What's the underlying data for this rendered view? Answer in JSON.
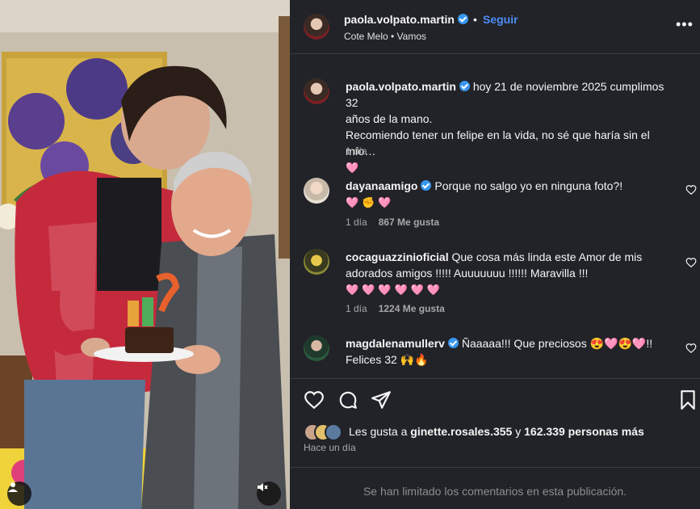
{
  "post": {
    "username": "paola.volpato.martin",
    "dot": "•",
    "follow_label": "Seguir",
    "audio": "Cote Melo • Vamos",
    "more_label": "•••"
  },
  "caption": {
    "username": "paola.volpato.martin",
    "text_line1": "hoy 21 de noviembre 2025 cumplimos 32",
    "text_line2": "años de la mano.",
    "text_line3": "Recomiendo tener un felipe en la vida, no sé que haría sin el mío…",
    "emoji": "🩷",
    "time": "1 día"
  },
  "comments": [
    {
      "username": "dayanaamigo",
      "text": "Porque no salgo yo en ninguna foto?!",
      "emoji": "🩷✊🩷",
      "time": "1 día",
      "likes": "867 Me gusta"
    },
    {
      "username": "cocaguazzinioficial",
      "text": "Que cosa más linda este Amor de mis adorados amigos !!!!! Auuuuuuu !!!!!! Maravilla !!!",
      "emoji": "🩷🩷🩷🩷🩷🩷",
      "time": "1 día",
      "likes": "1224 Me gusta"
    },
    {
      "username": "magdalenamullerv",
      "text": "Ñaaaaa!!! Que preciosos 😍🩷😍🩷!!",
      "text2": "Felices 32 🙌🔥"
    }
  ],
  "likes": {
    "prefix": "Les gusta a",
    "user": "ginette.rosales.355",
    "middle": "y",
    "count": "162.339 personas más"
  },
  "time_ago": "Hace un día",
  "limited_notice": "Se han limitado los comentarios en esta publicación.",
  "icons": {
    "like": "heart-icon",
    "comment": "comment-icon",
    "share": "share-icon",
    "save": "bookmark-icon",
    "user_tag": "user-icon",
    "mute": "muted-speaker-icon"
  },
  "colors": {
    "panel_bg": "#212328",
    "link_blue": "#4f8cf7",
    "verified": "#3897f0"
  }
}
